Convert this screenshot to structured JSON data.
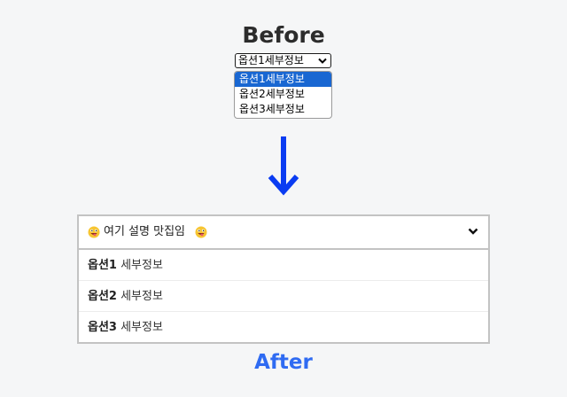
{
  "before": {
    "title": "Before",
    "select_value": "옵션1세부정보",
    "options": [
      "옵션1세부정보",
      "옵션2세부정보",
      "옵션3세부정보"
    ],
    "selected_index": 0
  },
  "after": {
    "title": "After",
    "header_label": "여기 설명 맛집임",
    "header_emoji": "grinning-tongue-emoji",
    "options": [
      {
        "bold": "옵션1",
        "rest": " 세부정보"
      },
      {
        "bold": "옵션2",
        "rest": " 세부정보"
      },
      {
        "bold": "옵션3",
        "rest": " 세부정보"
      }
    ]
  },
  "colors": {
    "arrow": "#0a3cf2",
    "after_title": "#2f6bf2",
    "native_selected": "#1967d2"
  }
}
